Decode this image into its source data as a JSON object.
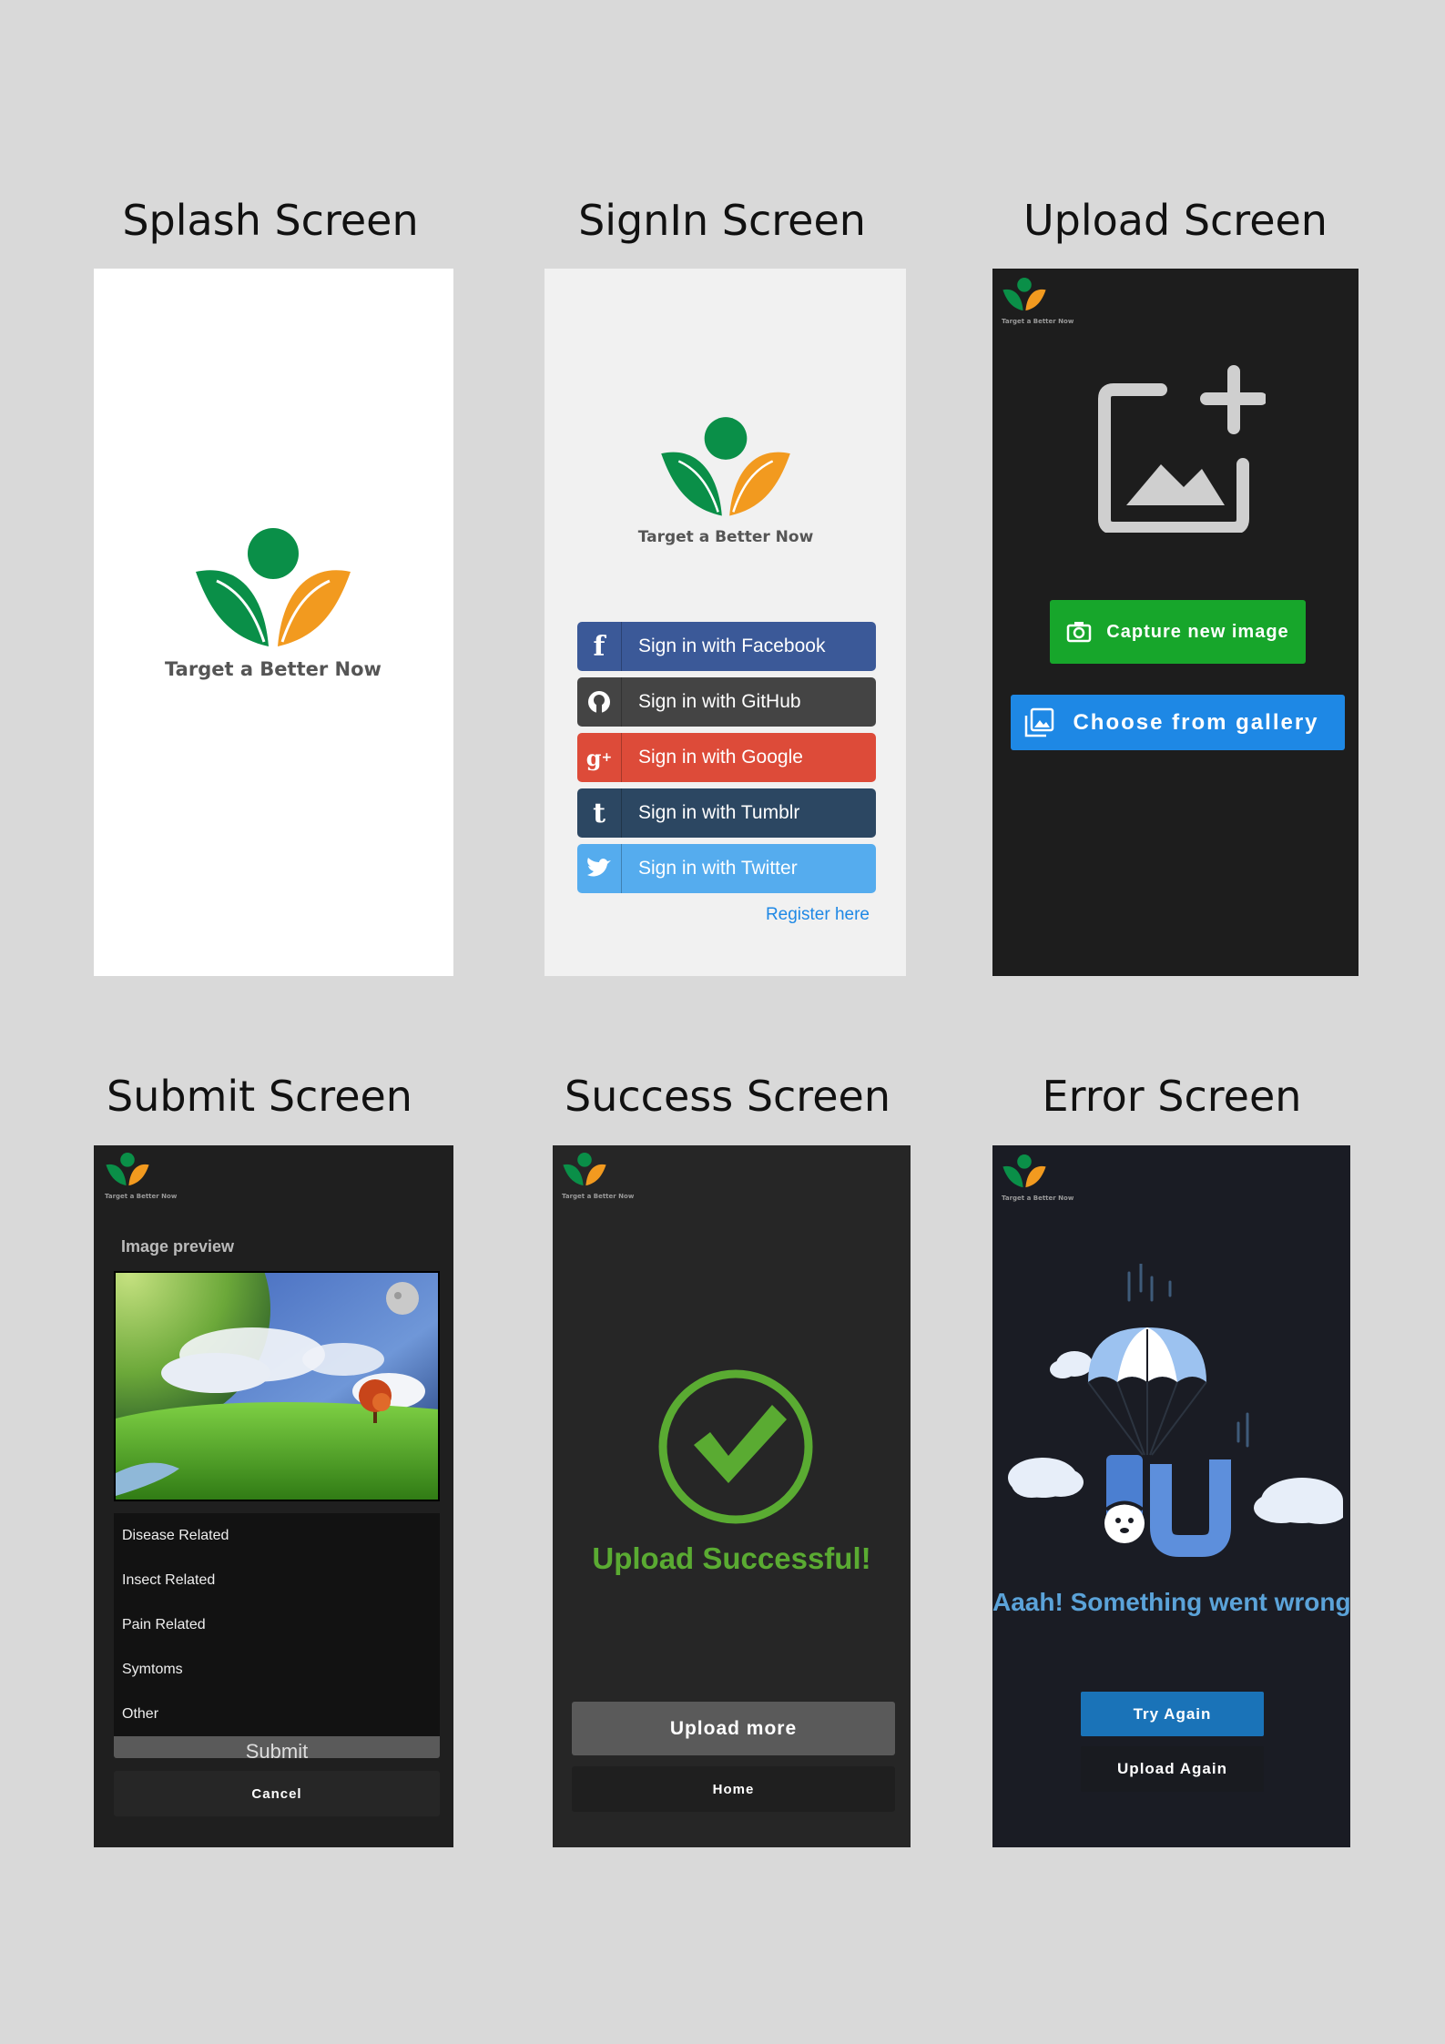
{
  "titles": {
    "splash": "Splash Screen",
    "signin": "SignIn Screen",
    "upload": "Upload Screen",
    "submit": "Submit Screen",
    "success": "Success Screen",
    "error": "Error Screen"
  },
  "brand": {
    "name": "Target a Better Now",
    "colors": {
      "green": "#0a8f48",
      "orange": "#f29a1f"
    }
  },
  "signin": {
    "buttons": [
      {
        "label": "Sign in with Facebook",
        "icon": "facebook-icon",
        "color": "#3b5998"
      },
      {
        "label": "Sign in with GitHub",
        "icon": "github-icon",
        "color": "#444444"
      },
      {
        "label": "Sign in with Google",
        "icon": "google-plus-icon",
        "color": "#dd4b39"
      },
      {
        "label": "Sign in with Tumblr",
        "icon": "tumblr-icon",
        "color": "#2c4762"
      },
      {
        "label": "Sign in with Twitter",
        "icon": "twitter-icon",
        "color": "#55acee"
      }
    ],
    "register_link": "Register here"
  },
  "upload": {
    "capture_label": "Capture new image",
    "gallery_label": "Choose from gallery",
    "capture_color": "#17a62b",
    "gallery_color": "#1e88e5"
  },
  "submit": {
    "preview_label": "Image preview",
    "dropdown_options": [
      "Disease Related",
      "Insect Related",
      "Pain Related",
      "Symtoms",
      "Other"
    ],
    "submit_label": "Submit",
    "cancel_label": "Cancel"
  },
  "success": {
    "message": "Upload Successful!",
    "upload_more_label": "Upload more",
    "home_label": "Home",
    "color": "#5aab32"
  },
  "error": {
    "message": "Aaah! Something went wrong",
    "try_again_label": "Try Again",
    "upload_again_label": "Upload Again",
    "color": "#5ba3d9"
  }
}
